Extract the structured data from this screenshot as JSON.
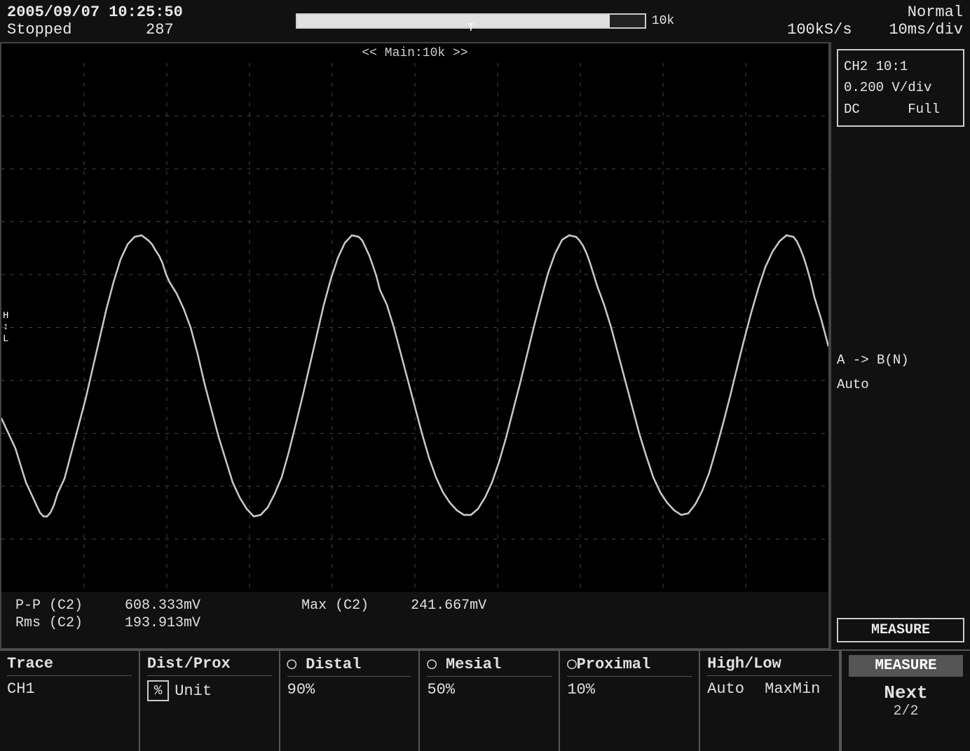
{
  "header": {
    "datetime": "2005/09/07 10:25:50",
    "status": "Stopped",
    "counter": "287",
    "progress_label": "10k",
    "mode": "Normal",
    "sample_rate": "100kS/s",
    "time_div": "10ms/div",
    "main_label": "<< Main:10k >>"
  },
  "ch2_info": {
    "probe": "CH2 10:1",
    "voltage": "0.200 V/div",
    "coupling": "DC",
    "bandwidth": "Full"
  },
  "trigger_info": {
    "line1": "A -> B(N)",
    "line2": "Auto"
  },
  "measurements": {
    "pp_label": "P-P (C2)",
    "pp_value": "608.333mV",
    "max_label": "Max (C2)",
    "max_value": "241.667mV",
    "rms_label": "Rms (C2)",
    "rms_value": "193.913mV"
  },
  "bottom_bar": {
    "cells": [
      {
        "title": "Trace",
        "value": "CH1"
      },
      {
        "title": "Dist/Prox",
        "value": "% Unit",
        "has_unit_box": true
      },
      {
        "title": "Distal",
        "value": "90%",
        "has_icon": true
      },
      {
        "title": "Mesial",
        "value": "50%",
        "has_icon": true
      },
      {
        "title": "Proximal",
        "value": "10%",
        "has_icon": true
      },
      {
        "title": "High/Low",
        "value": "Auto MaxMin"
      }
    ],
    "measure_panel": {
      "header": "MEASURE",
      "next_label": "Next",
      "page": "2/2"
    }
  },
  "trigger_marker": "T"
}
